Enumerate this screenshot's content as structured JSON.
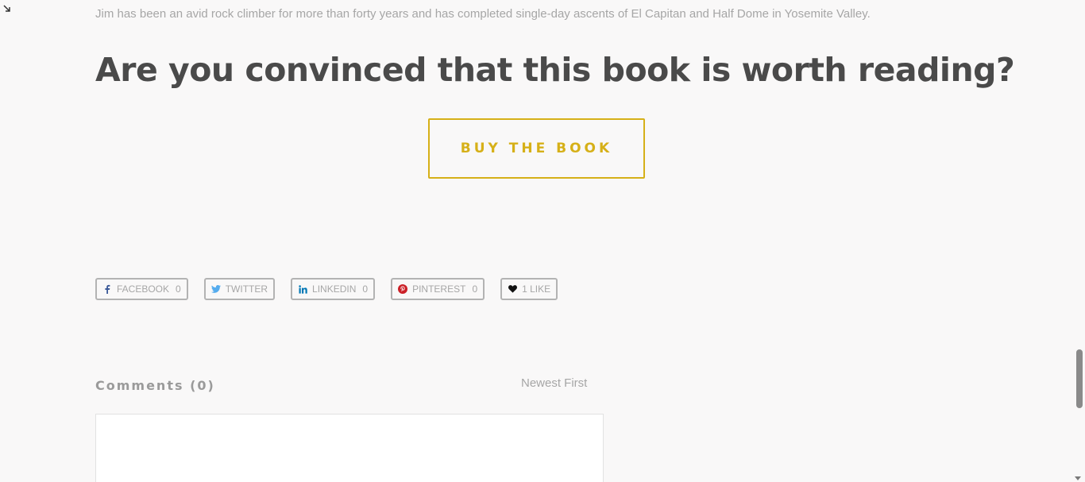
{
  "content": {
    "bio": "Jim has been an avid rock climber for more than forty years and has completed single-day ascents of El Capitan and Half Dome in Yosemite Valley.",
    "headline": "Are you convinced that this book is worth reading?",
    "buy_button": "BUY THE BOOK"
  },
  "share": {
    "facebook": {
      "label": "FACEBOOK",
      "count": "0",
      "icon": "facebook-icon",
      "color": "#3b5998"
    },
    "twitter": {
      "label": "TWITTER",
      "icon": "twitter-icon",
      "color": "#55acee"
    },
    "linkedin": {
      "label": "LINKEDIN",
      "count": "0",
      "icon": "linkedin-icon",
      "color": "#0077b5"
    },
    "pinterest": {
      "label": "PINTEREST",
      "count": "0",
      "icon": "pinterest-icon",
      "color": "#cb2027"
    },
    "like": {
      "label": "1 LIKE",
      "icon": "heart-icon",
      "color": "#111111"
    }
  },
  "comments": {
    "title": "Comments (0)",
    "sort": "Newest First"
  },
  "colors": {
    "accent": "#d6b018",
    "heading": "#4a4a4a",
    "muted": "#a6a6a6"
  }
}
